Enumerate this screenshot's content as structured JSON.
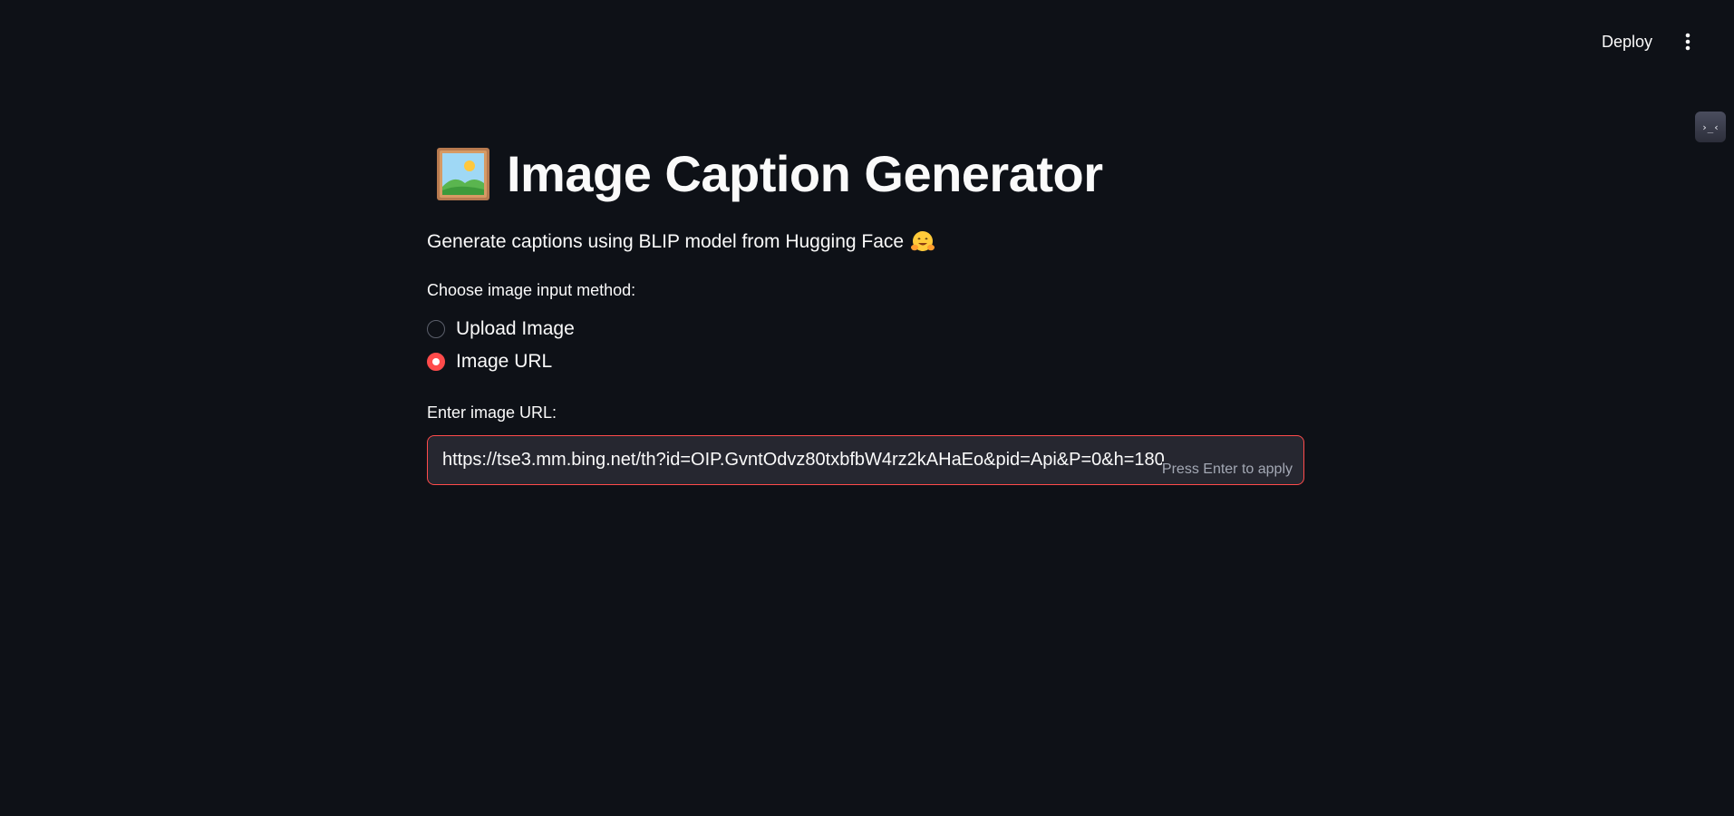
{
  "header": {
    "deploy_label": "Deploy",
    "menu_icon": "vertical-dots-icon",
    "side_widget_label": "›_‹"
  },
  "main": {
    "title": "Image Caption Generator",
    "title_icon": "framed-picture-icon",
    "subtitle": "Generate captions using BLIP model from Hugging Face",
    "subtitle_icon": "hugging-face-icon",
    "input_method": {
      "label": "Choose image input method:",
      "options": [
        {
          "label": "Upload Image",
          "selected": false
        },
        {
          "label": "Image URL",
          "selected": true
        }
      ]
    },
    "url_field": {
      "label": "Enter image URL:",
      "value": "https://tse3.mm.bing.net/th?id=OIP.GvntOdvz80txbfbW4rz2kAHaEo&pid=Api&P=0&h=180",
      "hint": "Press Enter to apply"
    }
  },
  "colors": {
    "background": "#0e1117",
    "accent": "#ff4b4b",
    "input_background": "#262730",
    "text": "#fafafa"
  }
}
